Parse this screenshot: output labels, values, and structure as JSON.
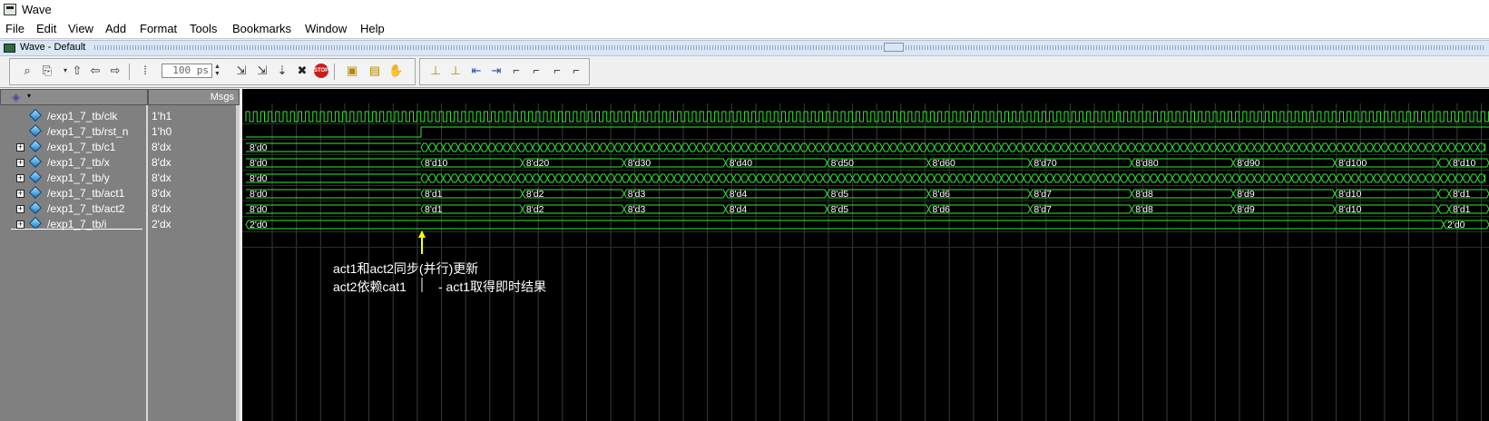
{
  "window": {
    "title": "Wave"
  },
  "menu": [
    "File",
    "Edit",
    "View",
    "Add",
    "Format",
    "Tools",
    "Bookmarks",
    "Window",
    "Help"
  ],
  "wave_window": {
    "title": "Wave - Default"
  },
  "toolbar": {
    "time_step": "100 ps",
    "buttons": [
      "search-icon",
      "find-next-icon",
      "go-up-icon",
      "back-icon",
      "forward-icon",
      "insert-cursor-icon",
      "step-icon",
      "step-over-icon",
      "continue-icon",
      "break-icon",
      "stop-icon",
      "restart-icon",
      "zoom-fit-icon",
      "zoom-in-icon",
      "edge-prev-icon",
      "edge-next-icon",
      "falling-edge-icon",
      "rising-edge-icon",
      "cursor-left-icon",
      "cursor-right-icon",
      "cursor-lock-icon",
      "cursor-unlock-icon"
    ]
  },
  "panes": {
    "msgs_header": "Msgs"
  },
  "signals": [
    {
      "name": "/exp1_7_tb/clk",
      "value": "1'h1",
      "expandable": false
    },
    {
      "name": "/exp1_7_tb/rst_n",
      "value": "1'h0",
      "expandable": false
    },
    {
      "name": "/exp1_7_tb/c1",
      "value": "8'dx",
      "expandable": true
    },
    {
      "name": "/exp1_7_tb/x",
      "value": "8'dx",
      "expandable": true
    },
    {
      "name": "/exp1_7_tb/y",
      "value": "8'dx",
      "expandable": true
    },
    {
      "name": "/exp1_7_tb/act1",
      "value": "8'dx",
      "expandable": true
    },
    {
      "name": "/exp1_7_tb/act2",
      "value": "8'dx",
      "expandable": true
    },
    {
      "name": "/exp1_7_tb/i",
      "value": "2'dx",
      "expandable": true
    }
  ],
  "waves": {
    "c1_initial": "8'd0",
    "x_initial": "8'd0",
    "x_labels": [
      "8'd10",
      "8'd20",
      "8'd30",
      "8'd40",
      "8'd50",
      "8'd60",
      "8'd70",
      "8'd80",
      "8'd90",
      "8'd100",
      "8'd10"
    ],
    "y_initial": "8'd0",
    "act1_initial": "8'd0",
    "act1_labels": [
      "8'd1",
      "8'd2",
      "8'd3",
      "8'd4",
      "8'd5",
      "8'd6",
      "8'd7",
      "8'd8",
      "8'd9",
      "8'd10",
      "8'd1"
    ],
    "act2_initial": "8'd0",
    "act2_labels": [
      "8'd1",
      "8'd2",
      "8'd3",
      "8'd4",
      "8'd5",
      "8'd6",
      "8'd7",
      "8'd8",
      "8'd9",
      "8'd10",
      "8'd1"
    ],
    "i_initial": "2'd0",
    "i_final": "2'd0"
  },
  "annotation": {
    "line1": "act1和act2同步(并行)更新",
    "line2a": "act2依赖cat1",
    "line2b": "- act1取得即时结果"
  },
  "colors": {
    "wave": "#33e633",
    "cursor": "#ffff00",
    "background": "#000000",
    "panes": "#808080"
  }
}
